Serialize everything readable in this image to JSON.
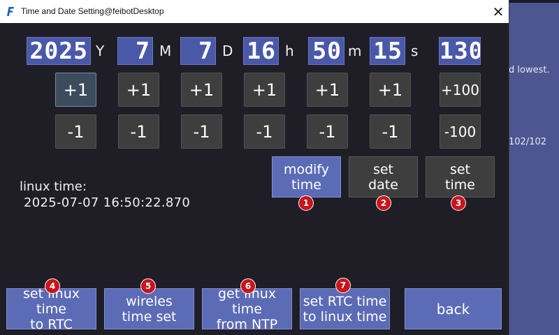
{
  "background": {
    "text_lowest": "d lowest.",
    "text_count": "102/102"
  },
  "window": {
    "title": "Time and Date Setting@feibotDesktop",
    "close_glyph": "✕"
  },
  "datetime": {
    "fields": [
      {
        "value": "2025",
        "unit": "Y"
      },
      {
        "value": "7",
        "unit": "M"
      },
      {
        "value": "7",
        "unit": "D"
      },
      {
        "value": "16",
        "unit": "h"
      },
      {
        "value": "50",
        "unit": "m"
      },
      {
        "value": "15",
        "unit": "s"
      },
      {
        "value": "130",
        "unit": ""
      }
    ],
    "increment_labels": [
      "+1",
      "+1",
      "+1",
      "+1",
      "+1",
      "+1",
      "+100"
    ],
    "decrement_labels": [
      "-1",
      "-1",
      "-1",
      "-1",
      "-1",
      "-1",
      "-100"
    ]
  },
  "actions": {
    "modify_time": "modify\ntime",
    "set_date": "set\ndate",
    "set_time": "set\ntime"
  },
  "linux_time": {
    "label": "linux time:",
    "value": "2025-07-07 16:50:22.870"
  },
  "bottom": {
    "set_linux_time_to_rtc": "set linux time\nto RTC",
    "wireless_time_set": "wireles\ntime set",
    "get_linux_time_from_ntp": "get linux time\nfrom NTP",
    "set_rtc_time_to_linux_time": "set RTC time\nto linux time",
    "back": "back"
  },
  "badges": [
    "1",
    "2",
    "3",
    "4",
    "5",
    "6",
    "7"
  ],
  "colors": {
    "window_bg": "#1f1e27",
    "digit_box": "#4a58a8",
    "blue_button": "#5c6bb5",
    "dark_button": "#3e3e3e",
    "badge": "#c8141c",
    "desktop_bg": "#4a5386"
  },
  "icons": {
    "app": "app-f-icon",
    "close": "close-icon"
  }
}
